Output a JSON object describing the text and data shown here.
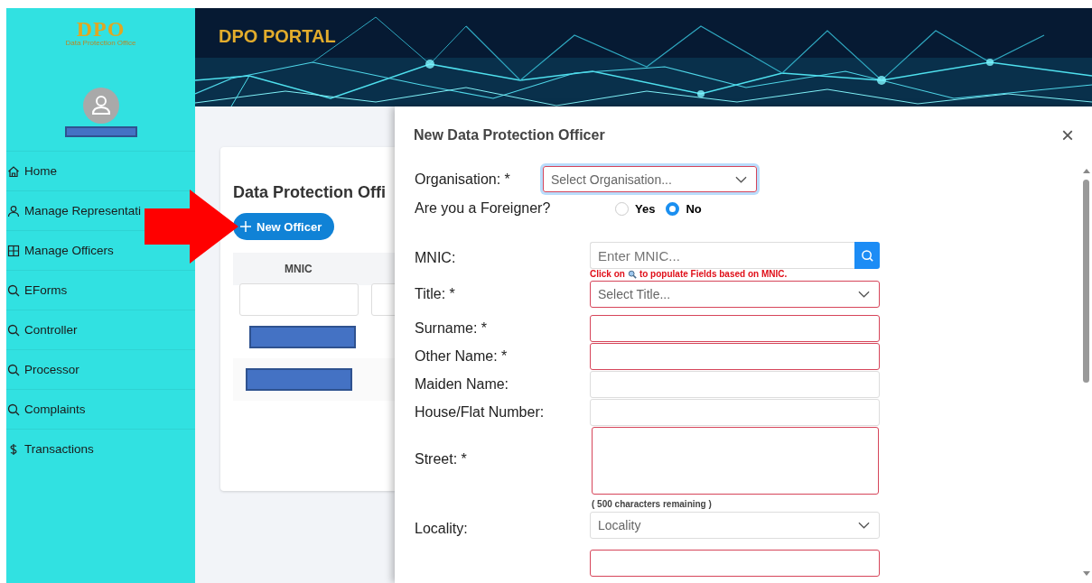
{
  "logo": {
    "mark": "DPO",
    "subtitle": "Data Protection Office"
  },
  "header": {
    "title": "DPO PORTAL"
  },
  "sidebar": {
    "items": [
      {
        "label": "Home"
      },
      {
        "label": "Manage Representati"
      },
      {
        "label": "Manage Officers"
      },
      {
        "label": "EForms"
      },
      {
        "label": "Controller"
      },
      {
        "label": "Processor"
      },
      {
        "label": "Complaints"
      },
      {
        "label": "Transactions"
      }
    ]
  },
  "page": {
    "title": "Data Protection Offi",
    "new_button": "New Officer",
    "table": {
      "columns": [
        "MNIC"
      ]
    }
  },
  "dialog": {
    "title": "New Data Protection Officer",
    "close": "×",
    "fields": [
      {
        "kind": "select",
        "label": "Organisation: *",
        "placeholder": "Select Organisation...",
        "required": true,
        "focused": true
      },
      {
        "kind": "radio",
        "label": "Are you a Foreigner?",
        "options": [
          {
            "label": "Yes",
            "selected": false
          },
          {
            "label": "No",
            "selected": true
          }
        ]
      },
      {
        "kind": "search",
        "label": "MNIC:",
        "placeholder": "Enter MNIC...",
        "hint_before": "Click on",
        "hint_after": "to populate Fields based on MNIC.",
        "required": false
      },
      {
        "kind": "select",
        "label": "Title: *",
        "placeholder": "Select Title...",
        "required": true,
        "focused": false
      },
      {
        "kind": "input",
        "label": "Surname: *",
        "required": true
      },
      {
        "kind": "input",
        "label": "Other Name: *",
        "required": true
      },
      {
        "kind": "input",
        "label": "Maiden Name:",
        "required": false
      },
      {
        "kind": "input",
        "label": "House/Flat Number:",
        "required": false
      },
      {
        "kind": "textarea",
        "label": "Street: *",
        "required": true,
        "counter": "( 500 characters remaining )"
      },
      {
        "kind": "select",
        "label": "Locality:",
        "placeholder": "Locality",
        "required": false,
        "focused": false
      },
      {
        "kind": "input",
        "required": true
      }
    ]
  }
}
